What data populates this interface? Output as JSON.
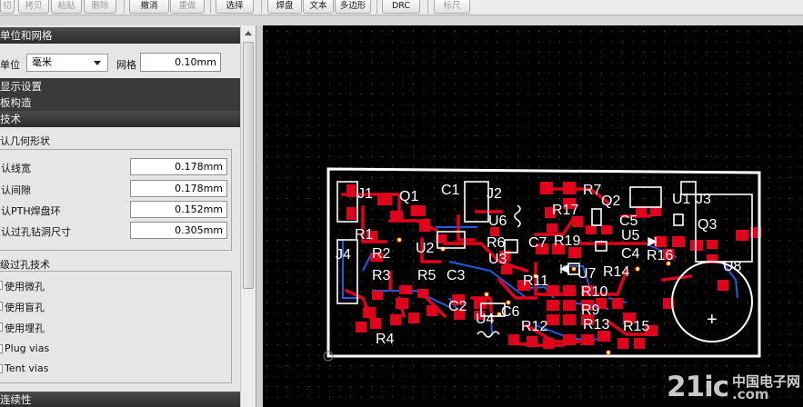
{
  "toolbar": {
    "buttons": [
      {
        "label": "切",
        "enabled": false
      },
      {
        "label": "拷贝",
        "enabled": false
      },
      {
        "label": "粘贴",
        "enabled": false
      },
      {
        "label": "删除",
        "enabled": false
      },
      {
        "label": "撤消",
        "enabled": true
      },
      {
        "label": "重做",
        "enabled": false
      },
      {
        "label": "选择",
        "enabled": true
      },
      {
        "label": "焊盘",
        "enabled": true
      },
      {
        "label": "文本",
        "enabled": true
      },
      {
        "label": "多边形",
        "enabled": true
      },
      {
        "label": "DRC",
        "enabled": true
      },
      {
        "label": "标尺",
        "enabled": false
      }
    ]
  },
  "left_panel": {
    "units_grid": {
      "header": "单位和网格",
      "unit_label": "单位",
      "unit_value": "毫米",
      "grid_label": "网格",
      "grid_value": "0.10mm"
    },
    "display_settings": "显示设置",
    "board_structure": "板构造",
    "technology": "技术",
    "default_geometry": {
      "header": "认几何形状",
      "rows": [
        {
          "label": "认线宽",
          "value": "0.178mm"
        },
        {
          "label": "认间隙",
          "value": "0.178mm"
        },
        {
          "label": "认PTH焊盘环",
          "value": "0.152mm"
        },
        {
          "label": "认过孔钻洞尺寸",
          "value": "0.305mm"
        }
      ]
    },
    "advanced_vias": {
      "header": "级过孔技术",
      "options": [
        {
          "label": "使用微孔"
        },
        {
          "label": "使用盲孔"
        },
        {
          "label": "使用埋孔"
        },
        {
          "label": "Plug vias"
        },
        {
          "label": "Tent vias"
        }
      ]
    },
    "connectivity": "连续性"
  },
  "canvas": {
    "background": "#000000",
    "grid_dot_color": "#3f6b3f",
    "top_copper_color": "#e3001b",
    "bottom_copper_color": "#1e5ce6",
    "silkscreen_color": "#ffffff",
    "designators": [
      "J1",
      "Q1",
      "C1",
      "J2",
      "R7",
      "Q2",
      "U1",
      "J3",
      "U6",
      "R17",
      "C5",
      "Q3",
      "R1",
      "U2",
      "R6",
      "C7",
      "R19",
      "U5",
      "C4",
      "R16",
      "J4",
      "R2",
      "U3",
      "R11",
      "U7",
      "R14",
      "U8",
      "R3",
      "R5",
      "C3",
      "R10",
      "C2",
      "R9",
      "C6",
      "R13",
      "U4",
      "R12",
      "R15",
      "R4",
      "+"
    ]
  },
  "watermark": {
    "logo": "21ic",
    "cn": "中国电子网",
    "site": ".com"
  }
}
